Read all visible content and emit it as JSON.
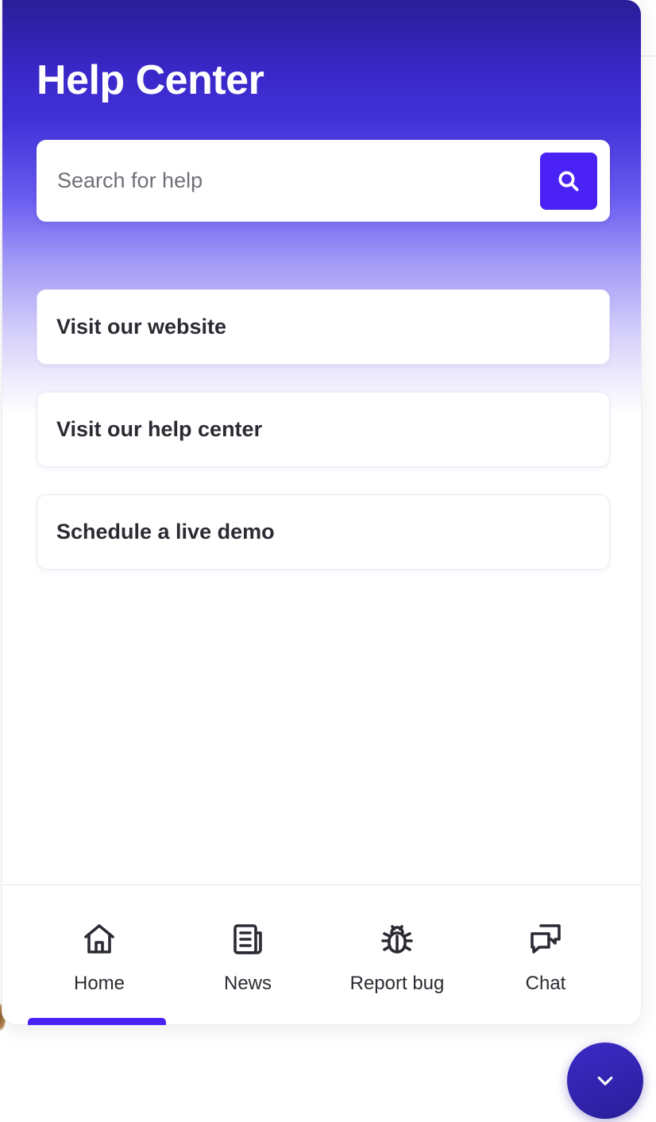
{
  "header": {
    "title": "Help Center"
  },
  "search": {
    "placeholder": "Search for help",
    "value": "",
    "button_icon": "search-icon"
  },
  "links": [
    {
      "label": "Visit our website"
    },
    {
      "label": "Visit our help center"
    },
    {
      "label": "Schedule a live demo"
    }
  ],
  "nav": {
    "active": "Home",
    "items": [
      {
        "label": "Home",
        "icon": "home-icon"
      },
      {
        "label": "News",
        "icon": "news-icon"
      },
      {
        "label": "Report bug",
        "icon": "bug-icon"
      },
      {
        "label": "Chat",
        "icon": "chat-icon"
      }
    ]
  },
  "launcher": {
    "icon": "chevron-down-icon"
  },
  "colors": {
    "accent": "#4a22f5",
    "header_top": "#2a1e9a",
    "text": "#2b2b33"
  }
}
